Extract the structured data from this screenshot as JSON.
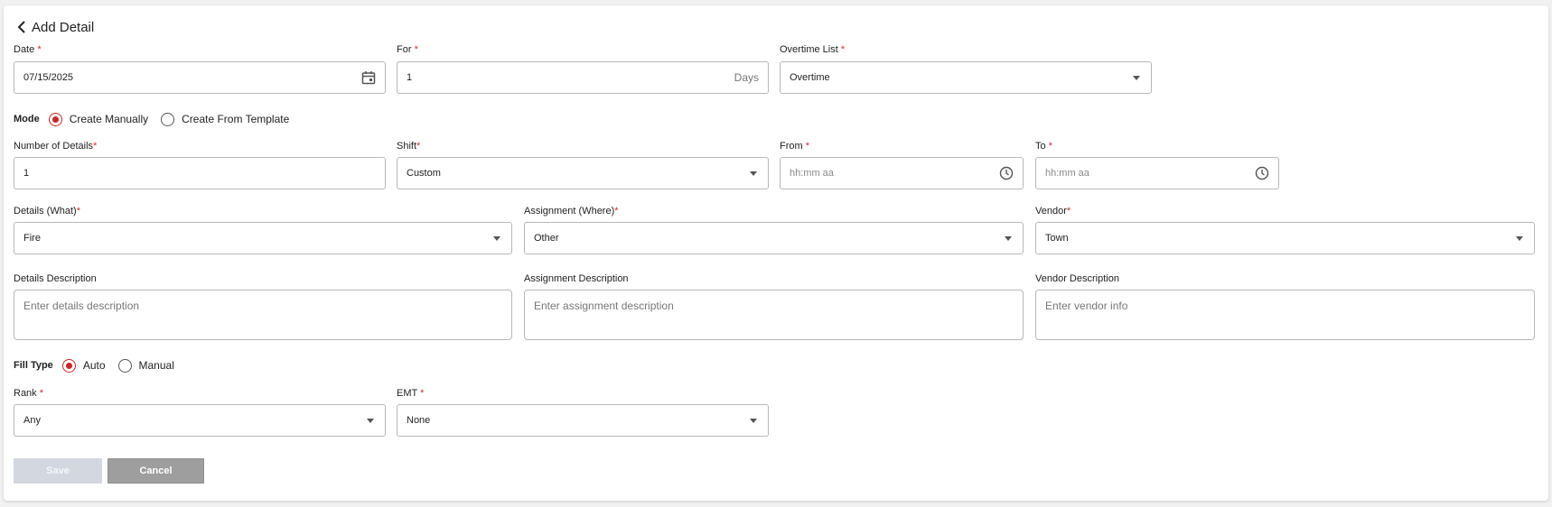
{
  "header": {
    "title": "Add Detail"
  },
  "date": {
    "label": "Date",
    "value": "07/15/2025"
  },
  "for": {
    "label": "For",
    "value": "1",
    "suffix": "Days"
  },
  "overtime_list": {
    "label": "Overtime List",
    "value": "Overtime"
  },
  "mode": {
    "label": "Mode",
    "options": [
      "Create Manually",
      "Create From Template"
    ],
    "selected": "Create Manually"
  },
  "number_of_details": {
    "label": "Number of Details",
    "value": "1"
  },
  "shift": {
    "label": "Shift",
    "value": "Custom"
  },
  "from": {
    "label": "From",
    "placeholder": "hh:mm aa"
  },
  "to": {
    "label": "To",
    "placeholder": "hh:mm aa"
  },
  "details_what": {
    "label": "Details (What)",
    "value": "Fire"
  },
  "assignment_where": {
    "label": "Assignment (Where)",
    "value": "Other"
  },
  "vendor": {
    "label": "Vendor",
    "value": "Town"
  },
  "details_description": {
    "label": "Details Description",
    "placeholder": "Enter details description"
  },
  "assignment_description": {
    "label": "Assignment Description",
    "placeholder": "Enter assignment description"
  },
  "vendor_description": {
    "label": "Vendor Description",
    "placeholder": "Enter vendor info"
  },
  "fill_type": {
    "label": "Fill Type",
    "options": [
      "Auto",
      "Manual"
    ],
    "selected": "Auto"
  },
  "rank": {
    "label": "Rank",
    "value": "Any"
  },
  "emt": {
    "label": "EMT",
    "value": "None"
  },
  "actions": {
    "save": "Save",
    "cancel": "Cancel"
  },
  "required_mark": "*",
  "colors": {
    "accent": "#c62828",
    "required": "#d32f2f",
    "save_disabled": "#d3d8e0",
    "cancel": "#9e9e9e"
  },
  "icons": [
    "chevron-left-icon",
    "calendar-icon",
    "clock-icon",
    "caret-down-icon"
  ]
}
